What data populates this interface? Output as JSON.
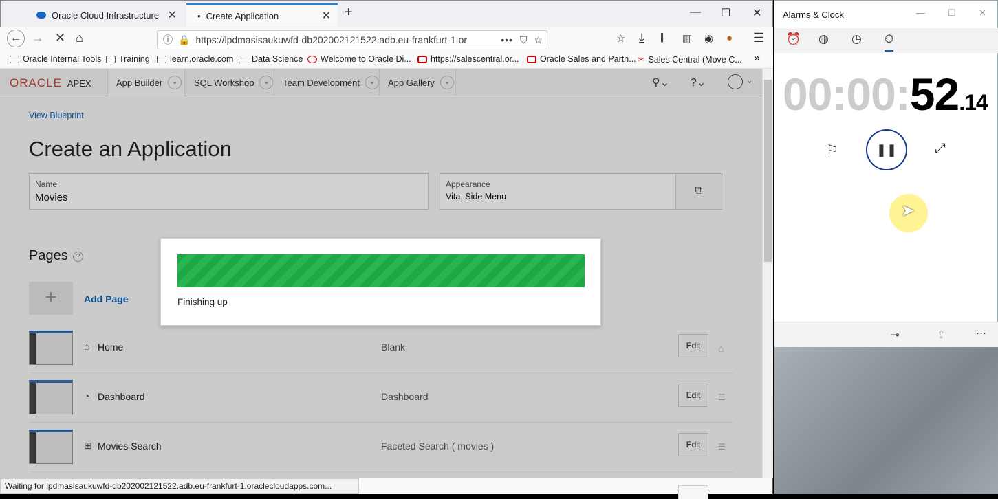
{
  "browser": {
    "tabs": [
      {
        "label": "Oracle Cloud Infrastructure"
      },
      {
        "label": "Create Application"
      }
    ],
    "url": "https://lpdmasisaukuwfd-db202002121522.adb.eu-frankfurt-1.or",
    "bookmarks": [
      "Oracle Internal Tools",
      "Training",
      "learn.oracle.com",
      "Data Science",
      "Welcome to Oracle Di...",
      "https://salescentral.or...",
      "Oracle Sales and Partn...",
      "Sales Central (Move C..."
    ],
    "status_text": "Waiting for lpdmasisaukuwfd-db202002121522.adb.eu-frankfurt-1.oraclecloudapps.com..."
  },
  "apex": {
    "logo_oracle": "ORACLE",
    "logo_apex": "APEX",
    "menus": [
      "App Builder",
      "SQL Workshop",
      "Team Development",
      "App Gallery"
    ]
  },
  "page": {
    "view_blueprint": "View Blueprint",
    "title": "Create an Application",
    "name_label": "Name",
    "name_value": "Movies",
    "appearance_label": "Appearance",
    "appearance_value": "Vita, Side Menu",
    "pages_heading": "Pages",
    "add_page": "Add Page",
    "edit_label": "Edit",
    "rows": [
      {
        "name": "Home",
        "type": "Blank"
      },
      {
        "name": "Dashboard",
        "type": "Dashboard"
      },
      {
        "name": "Movies Search",
        "type": "Faceted Search ( movies )"
      }
    ]
  },
  "dialog": {
    "message": "Finishing up",
    "progress_fraction": 1.0
  },
  "alarms": {
    "title": "Alarms & Clock",
    "time_dim": "00:00:",
    "time_seconds": "52",
    "time_fraction": ".14"
  }
}
